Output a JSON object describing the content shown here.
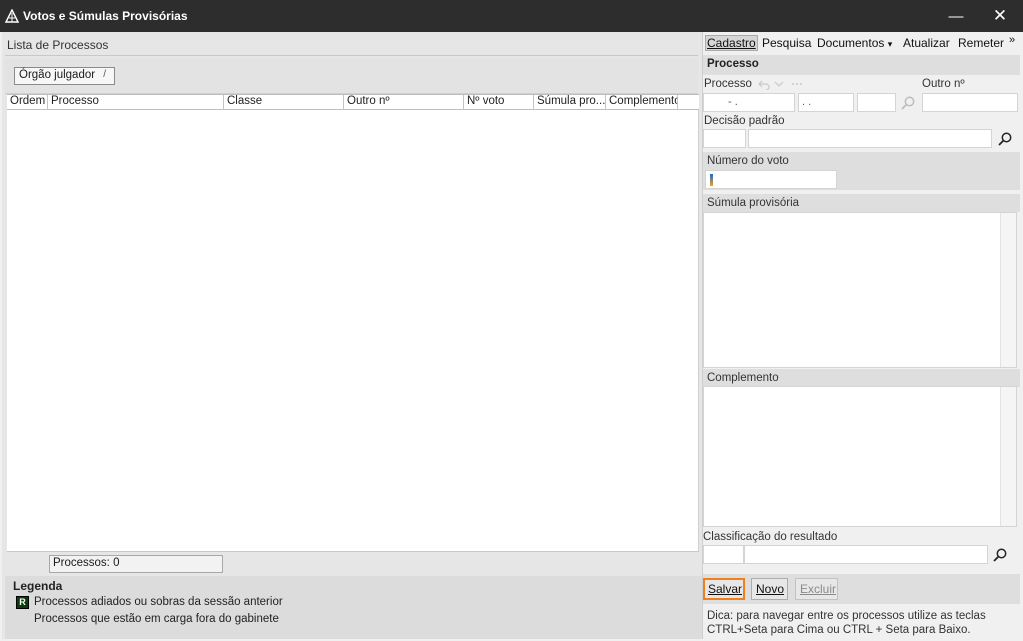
{
  "window": {
    "title": "Votos e Súmulas Provisórias",
    "minimize": "—",
    "close": "✕"
  },
  "left": {
    "header": "Lista de Processos",
    "group_chip": "Órgão julgador",
    "group_sort": "/",
    "columns": [
      "Ordem",
      "Processo",
      "Classe",
      "Outro nº",
      "Nº voto",
      "Súmula pro...",
      "Complemento"
    ],
    "count_label": "Processos: 0",
    "legend_title": "Legenda",
    "legend_icon_letter": "R",
    "legend_items": [
      "Processos adiados ou sobras da sessão anterior",
      "Processos que estão em carga fora do gabinete"
    ]
  },
  "right": {
    "menu": [
      "Cadastro",
      "Pesquisa",
      "Documentos",
      "Atualizar",
      "Remeter"
    ],
    "menu_more": "»",
    "menu_dropdown": "▾",
    "section_title": "Processo",
    "processo_label": "Processo",
    "processo_mask1": "-  .",
    "processo_mask2": ".  .",
    "outro_label": "Outro nº",
    "decisao_label": "Decisão padrão",
    "numero_voto_label": "Número do voto",
    "sumula_label": "Súmula provisória",
    "complemento_label": "Complemento",
    "classificacao_label": "Classificação do resultado",
    "buttons": {
      "salvar": "Salvar",
      "novo": "Novo",
      "excluir": "Excluir"
    },
    "hint": "Dica: para navegar entre os processos utilize as teclas CTRL+Seta para Cima ou CTRL + Seta para Baixo."
  },
  "icons": {
    "app": "triangle-logo-icon",
    "search": "magnifier-icon",
    "nav": "undo-icon",
    "more": "ellipsis-icon"
  },
  "colors": {
    "titlebar": "#2d2d2d",
    "focus_accent": "#f07f1d",
    "legend_icon": "#0b3d0b"
  }
}
